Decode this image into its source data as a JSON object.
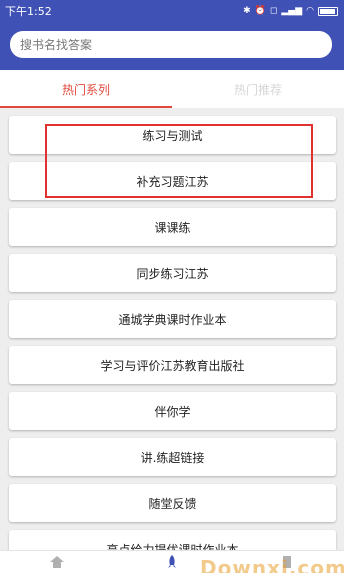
{
  "status_bar": {
    "time": "下午1:52",
    "icons": [
      "bluetooth-icon",
      "alarm-icon",
      "mute-icon",
      "signal-icon",
      "wifi-icon",
      "battery-icon"
    ]
  },
  "search": {
    "placeholder": "搜书名找答案"
  },
  "tabs": [
    {
      "label": "热门系列",
      "active": true
    },
    {
      "label": "热门推荐",
      "active": false
    }
  ],
  "list": {
    "items": [
      "练习与测试",
      "补充习题江苏",
      "课课练",
      "同步练习江苏",
      "通城学典课时作业本",
      "学习与评价江苏教育出版社",
      "伴你学",
      "讲.练超链接",
      "随堂反馈",
      "亮点给力提优课时作业本"
    ]
  },
  "bottom_nav": {
    "items": [
      "home-icon",
      "rocket-icon",
      "book-icon"
    ]
  },
  "watermark": "Downxi.com",
  "colors": {
    "header": "#3f51b5",
    "active_tab": "#e04a3c",
    "highlight_box": "#e03131",
    "list_bg": "#eeeeee"
  }
}
